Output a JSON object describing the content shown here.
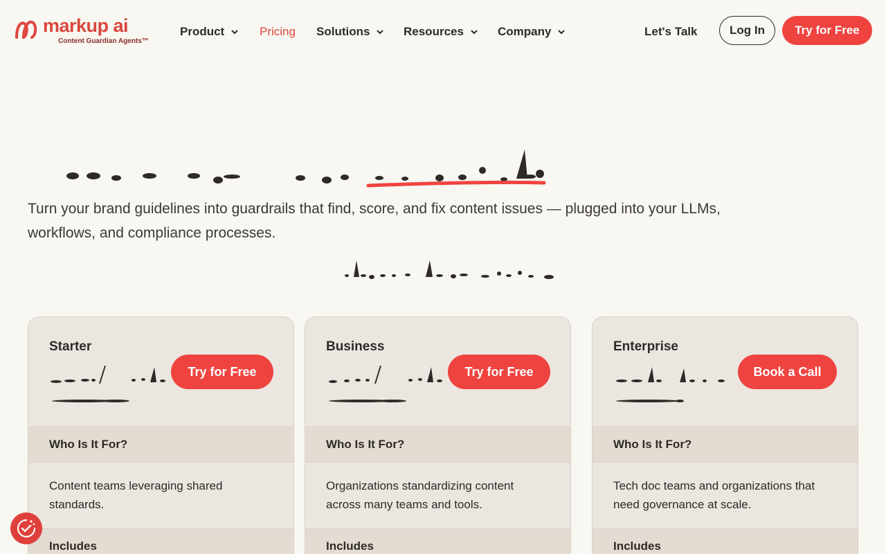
{
  "header": {
    "logo": {
      "name": "markup ai",
      "tagline": "Content Guardian Agents™"
    },
    "nav": [
      {
        "label": "Product",
        "has_dropdown": true
      },
      {
        "label": "Pricing",
        "has_dropdown": false,
        "active": true
      },
      {
        "label": "Solutions",
        "has_dropdown": true
      },
      {
        "label": "Resources",
        "has_dropdown": true
      },
      {
        "label": "Company",
        "has_dropdown": true
      }
    ],
    "lets_talk": "Let's Talk",
    "login": "Log In",
    "try_free": "Try for Free"
  },
  "hero": {
    "subtitle": "Turn your brand guidelines into guardrails that find, score, and fix content issues — plugged into your LLMs, workflows, and compliance processes."
  },
  "plans": [
    {
      "name": "Starter",
      "cta": "Try for Free",
      "who_label": "Who Is It For?",
      "who_text": "Content teams leveraging shared standards.",
      "includes_label": "Includes"
    },
    {
      "name": "Business",
      "cta": "Try for Free",
      "who_label": "Who Is It For?",
      "who_text": "Organizations standardizing content across many teams and tools.",
      "includes_label": "Includes"
    },
    {
      "name": "Enterprise",
      "cta": "Book a Call",
      "who_label": "Who Is It For?",
      "who_text": "Tech doc teams and organizations that need governance at scale.",
      "includes_label": "Includes"
    }
  ],
  "colors": {
    "accent": "#ef4340",
    "background": "#f8f7f1",
    "card": "#ece6e0",
    "card_section": "#e4dcd2"
  },
  "icons": {
    "chevron": "chevron-down-icon",
    "widget": "cookie-consent-icon"
  }
}
